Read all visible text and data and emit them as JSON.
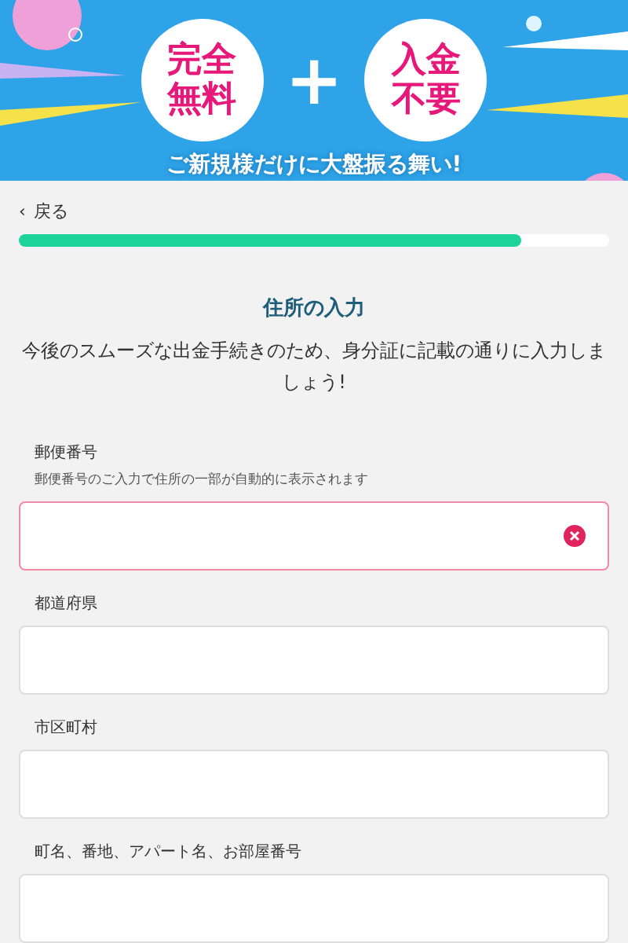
{
  "banner": {
    "badges": [
      {
        "lines": [
          "完全",
          "無料"
        ]
      },
      {
        "lines": [
          "入金",
          "不要"
        ]
      }
    ],
    "joiner": "+",
    "slogan": "ご新規様だけに大盤振る舞い!"
  },
  "back": {
    "icon": "‹",
    "label": "戻る"
  },
  "progress": {
    "level": 0.85
  },
  "title": "住所の入力",
  "description": "今後のスムーズな出金手続きのため、身分証に記載の通りに入力しましょう!",
  "fields": [
    {
      "label": "郵便番号",
      "hint": "郵便番号のご入力で住所の一部が自動的に表示されます",
      "error": true
    },
    {
      "label": "都道府県",
      "error": false
    },
    {
      "label": "市区町村",
      "error": false
    },
    {
      "label": "町名、番地、アパート名、お部屋番号",
      "error": false
    }
  ]
}
